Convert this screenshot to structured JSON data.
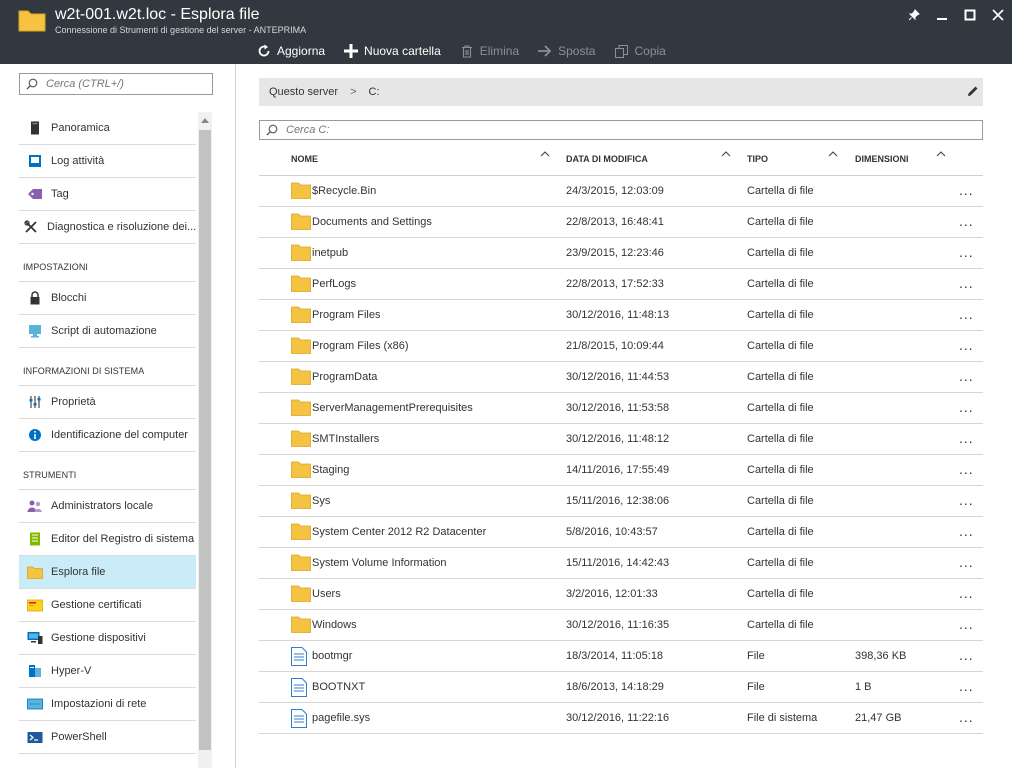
{
  "window": {
    "title": "w2t-001.w2t.loc - Esplora file",
    "subtitle": "Connessione di Strumenti di gestione del server - ANTEPRIMA"
  },
  "toolbar": [
    {
      "label": "Aggiorna",
      "icon": "refresh-icon",
      "enabled": true
    },
    {
      "label": "Nuova cartella",
      "icon": "plus-icon",
      "enabled": true
    },
    {
      "label": "Elimina",
      "icon": "trash-icon",
      "enabled": false
    },
    {
      "label": "Sposta",
      "icon": "arrow-right-icon",
      "enabled": false
    },
    {
      "label": "Copia",
      "icon": "copy-icon",
      "enabled": false
    }
  ],
  "sidebar": {
    "search_placeholder": "Cerca (CTRL+/)",
    "items_top": [
      {
        "label": "Panoramica",
        "icon": "server-icon"
      },
      {
        "label": "Log attività",
        "icon": "log-icon"
      },
      {
        "label": "Tag",
        "icon": "tag-icon"
      },
      {
        "label": "Diagnostica e risoluzione dei...",
        "icon": "tools-icon"
      }
    ],
    "section_settings": "IMPOSTAZIONI",
    "items_settings": [
      {
        "label": "Blocchi",
        "icon": "lock-icon"
      },
      {
        "label": "Script di automazione",
        "icon": "script-icon"
      }
    ],
    "section_sysinfo": "INFORMAZIONI DI SISTEMA",
    "items_sysinfo": [
      {
        "label": "Proprietà",
        "icon": "properties-icon"
      },
      {
        "label": "Identificazione del computer",
        "icon": "info-icon"
      }
    ],
    "section_tools": "STRUMENTI",
    "items_tools": [
      {
        "label": "Administrators locale",
        "icon": "users-icon"
      },
      {
        "label": "Editor del Registro di sistema",
        "icon": "registry-icon"
      },
      {
        "label": "Esplora file",
        "icon": "folder-icon",
        "active": true
      },
      {
        "label": "Gestione certificati",
        "icon": "certificate-icon"
      },
      {
        "label": "Gestione dispositivi",
        "icon": "devices-icon"
      },
      {
        "label": "Hyper-V",
        "icon": "hyperv-icon"
      },
      {
        "label": "Impostazioni di rete",
        "icon": "network-icon"
      },
      {
        "label": "PowerShell",
        "icon": "powershell-icon"
      }
    ]
  },
  "breadcrumb": {
    "root": "Questo server",
    "current": "C:"
  },
  "main_search_placeholder": "Cerca C:",
  "columns": {
    "name": "NOME",
    "modified": "DATA DI MODIFICA",
    "type": "TIPO",
    "size": "DIMENSIONI"
  },
  "files": [
    {
      "name": "$Recycle.Bin",
      "modified": "24/3/2015, 12:03:09",
      "type": "Cartella di file",
      "size": "",
      "kind": "folder"
    },
    {
      "name": "Documents and Settings",
      "modified": "22/8/2013, 16:48:41",
      "type": "Cartella di file",
      "size": "",
      "kind": "folder"
    },
    {
      "name": "inetpub",
      "modified": "23/9/2015, 12:23:46",
      "type": "Cartella di file",
      "size": "",
      "kind": "folder"
    },
    {
      "name": "PerfLogs",
      "modified": "22/8/2013, 17:52:33",
      "type": "Cartella di file",
      "size": "",
      "kind": "folder"
    },
    {
      "name": "Program Files",
      "modified": "30/12/2016, 11:48:13",
      "type": "Cartella di file",
      "size": "",
      "kind": "folder"
    },
    {
      "name": "Program Files (x86)",
      "modified": "21/8/2015, 10:09:44",
      "type": "Cartella di file",
      "size": "",
      "kind": "folder"
    },
    {
      "name": "ProgramData",
      "modified": "30/12/2016, 11:44:53",
      "type": "Cartella di file",
      "size": "",
      "kind": "folder"
    },
    {
      "name": "ServerManagementPrerequisites",
      "modified": "30/12/2016, 11:53:58",
      "type": "Cartella di file",
      "size": "",
      "kind": "folder"
    },
    {
      "name": "SMTInstallers",
      "modified": "30/12/2016, 11:48:12",
      "type": "Cartella di file",
      "size": "",
      "kind": "folder"
    },
    {
      "name": "Staging",
      "modified": "14/11/2016, 17:55:49",
      "type": "Cartella di file",
      "size": "",
      "kind": "folder"
    },
    {
      "name": "Sys",
      "modified": "15/11/2016, 12:38:06",
      "type": "Cartella di file",
      "size": "",
      "kind": "folder"
    },
    {
      "name": "System Center 2012 R2 Datacenter",
      "modified": "5/8/2016, 10:43:57",
      "type": "Cartella di file",
      "size": "",
      "kind": "folder"
    },
    {
      "name": "System Volume Information",
      "modified": "15/11/2016, 14:42:43",
      "type": "Cartella di file",
      "size": "",
      "kind": "folder"
    },
    {
      "name": "Users",
      "modified": "3/2/2016, 12:01:33",
      "type": "Cartella di file",
      "size": "",
      "kind": "folder"
    },
    {
      "name": "Windows",
      "modified": "30/12/2016, 11:16:35",
      "type": "Cartella di file",
      "size": "",
      "kind": "folder"
    },
    {
      "name": "bootmgr",
      "modified": "18/3/2014, 11:05:18",
      "type": "File",
      "size": "398,36 KB",
      "kind": "file"
    },
    {
      "name": "BOOTNXT",
      "modified": "18/6/2013, 14:18:29",
      "type": "File",
      "size": "1 B",
      "kind": "file"
    },
    {
      "name": "pagefile.sys",
      "modified": "30/12/2016, 11:22:16",
      "type": "File di sistema",
      "size": "21,47 GB",
      "kind": "file"
    }
  ],
  "more_label": "...",
  "colors": {
    "header_bg": "#32383f",
    "active_nav": "#c9ecf8",
    "folder": "#f5c242",
    "accent": "#0072c6"
  }
}
